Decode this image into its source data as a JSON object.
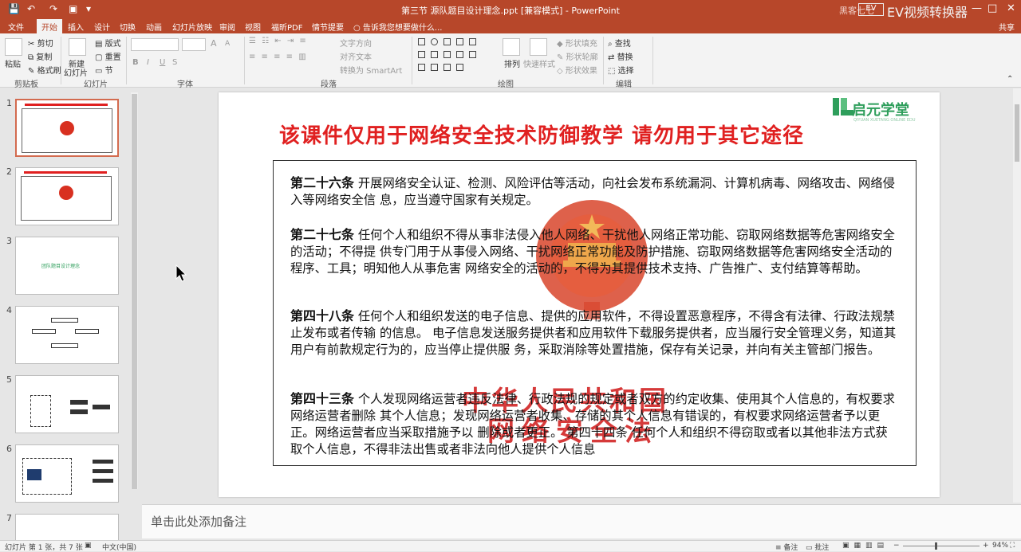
{
  "window": {
    "title": "第三节 源队题目设计理念.ppt [兼容模式] - PowerPoint",
    "watermark_small": "EV",
    "watermark_text": "EV视频转换器",
    "overlay_text": "黑客七七",
    "controls": [
      "—",
      "□",
      "✕"
    ]
  },
  "tabs": [
    {
      "label": "文件"
    },
    {
      "label": "开始"
    },
    {
      "label": "插入"
    },
    {
      "label": "设计"
    },
    {
      "label": "切换"
    },
    {
      "label": "动画"
    },
    {
      "label": "幻灯片放映"
    },
    {
      "label": "审阅"
    },
    {
      "label": "视图"
    },
    {
      "label": "福昕PDF"
    },
    {
      "label": "情节提要"
    }
  ],
  "tell_me": "告诉我您想要做什么...",
  "share": "共享",
  "ribbon": {
    "clipboard": {
      "paste": "粘贴",
      "cut": "剪切",
      "copy": "复制",
      "format_painter": "格式刷",
      "label": "剪贴板"
    },
    "slides": {
      "new_slide": "新建",
      "new_slide2": "幻灯片",
      "layout": "版式",
      "reset": "重置",
      "section": "节",
      "label": "幻灯片"
    },
    "font": {
      "label": "字体",
      "bold": "B",
      "italic": "I",
      "underline": "U",
      "shadow": "S",
      "grow": "A",
      "shrink": "A"
    },
    "paragraph": {
      "label": "段落",
      "text_direction": "文字方向",
      "align_text": "对齐文本",
      "smartart": "转换为 SmartArt"
    },
    "drawing": {
      "label": "绘图",
      "arrange": "排列",
      "quick_styles": "快速样式",
      "shape_fill": "形状填充",
      "shape_outline": "形状轮廓",
      "shape_effects": "形状效果"
    },
    "editing": {
      "label": "编辑",
      "find": "查找",
      "replace": "替换",
      "select": "选择"
    }
  },
  "thumbnails": [
    {
      "num": "1"
    },
    {
      "num": "2"
    },
    {
      "num": "3",
      "title": "团队题目设计理念"
    },
    {
      "num": "4"
    },
    {
      "num": "5"
    },
    {
      "num": "6"
    },
    {
      "num": "7"
    }
  ],
  "slide": {
    "logo": "启元学堂",
    "logo_sub": "QIYUAN XUETANG ONLINE EDU",
    "title": "该课件仅用于网络安全技术防御教学    请勿用于其它途径",
    "seal_line1": "中华人民共和国",
    "seal_line2": "网络安全法",
    "articles": [
      {
        "heading": "第二十六条",
        "body": "  开展网络安全认证、检测、风险评估等活动，向社会发布系统漏洞、计算机病毒、网络攻击、网络侵入等网络安全信 息，应当遵守国家有关规定。"
      },
      {
        "heading": "第二十七条",
        "body": "  任何个人和组织不得从事非法侵入他人网络、干扰他人网络正常功能、窃取网络数据等危害网络安全的活动；不得提 供专门用于从事侵入网络、干扰网络正常功能及防护措施、窃取网络数据等危害网络安全活动的程序、工具；明知他人从事危害 网络安全的活动的，不得为其提供技术支持、广告推广、支付结算等帮助。"
      },
      {
        "heading": "第四十八条",
        "body": " 任何个人和组织发送的电子信息、提供的应用软件，不得设置恶意程序，不得含有法律、行政法规禁止发布或者传输 的信息。 电子信息发送服务提供者和应用软件下载服务提供者，应当履行安全管理义务，知道其用户有前款规定行为的，应当停止提供服 务，采取消除等处置措施，保存有关记录，并向有关主管部门报告。"
      },
      {
        "heading": "第四十三条",
        "body": "  个人发现网络运营者违反法律、行政法规的规定或者双方的约定收集、使用其个人信息的，有权要求网络运营者删除 其个人信息；发现网络运营者收集、存储的其个人信息有错误的，有权要求网络运营者予以更正。网络运营者应当采取措施予以 删除或者更正。 第四十四条  任何个人和组织不得窃取或者以其他非法方式获取个人信息，不得非法出售或者非法向他人提供个人信息"
      }
    ]
  },
  "notes_placeholder": "单击此处添加备注",
  "status": {
    "slide_info": "幻灯片 第 1 张，共 7 张",
    "language": "中文(中国)",
    "notes": "备注",
    "comments": "批注",
    "zoom": "94%"
  }
}
